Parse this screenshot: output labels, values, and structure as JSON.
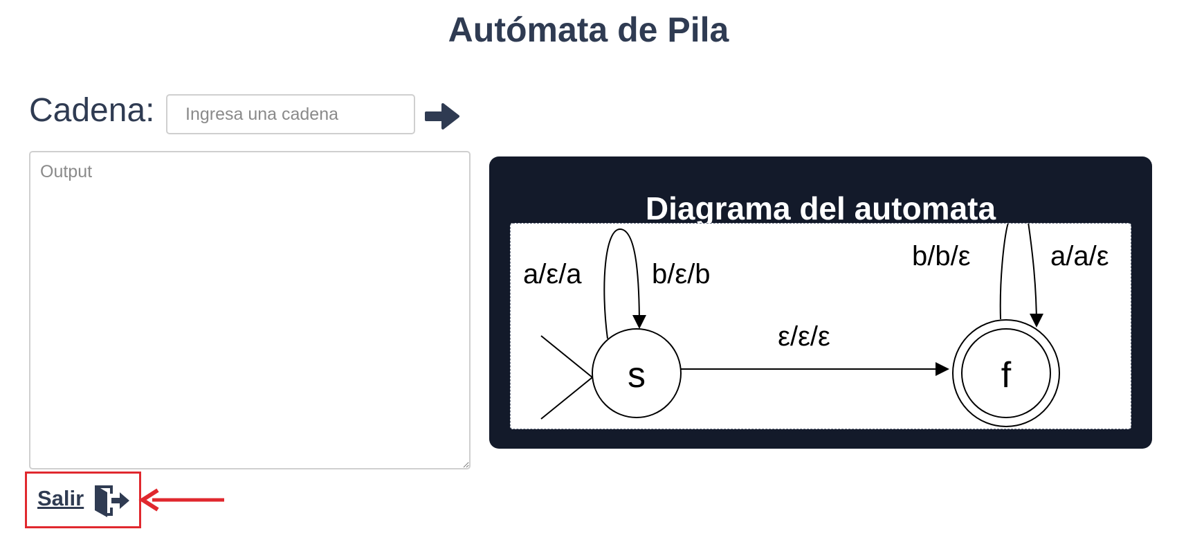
{
  "page": {
    "title": "Autómata de Pila"
  },
  "form": {
    "cadena_label": "Cadena:",
    "input_placeholder": "Ingresa una cadena",
    "input_value": "",
    "output_placeholder": "Output",
    "output_value": ""
  },
  "icons": {
    "submit": "arrow-right-icon",
    "exit": "door-exit-icon",
    "annotation": "red-arrow-annotation"
  },
  "diagram": {
    "title": "Diagrama del automata",
    "states": [
      "s",
      "f"
    ],
    "transitions": {
      "s_loop_left": "a/ε/a",
      "s_loop_right": "b/ε/b",
      "s_to_f": "ε/ε/ε",
      "f_loop_left": "b/b/ε",
      "f_loop_right": "a/a/ε"
    }
  },
  "footer": {
    "exit_label": "Salir"
  },
  "colors": {
    "text_primary": "#2f3b52",
    "card_bg": "#131a2a",
    "annotation_red": "#e0282e"
  }
}
